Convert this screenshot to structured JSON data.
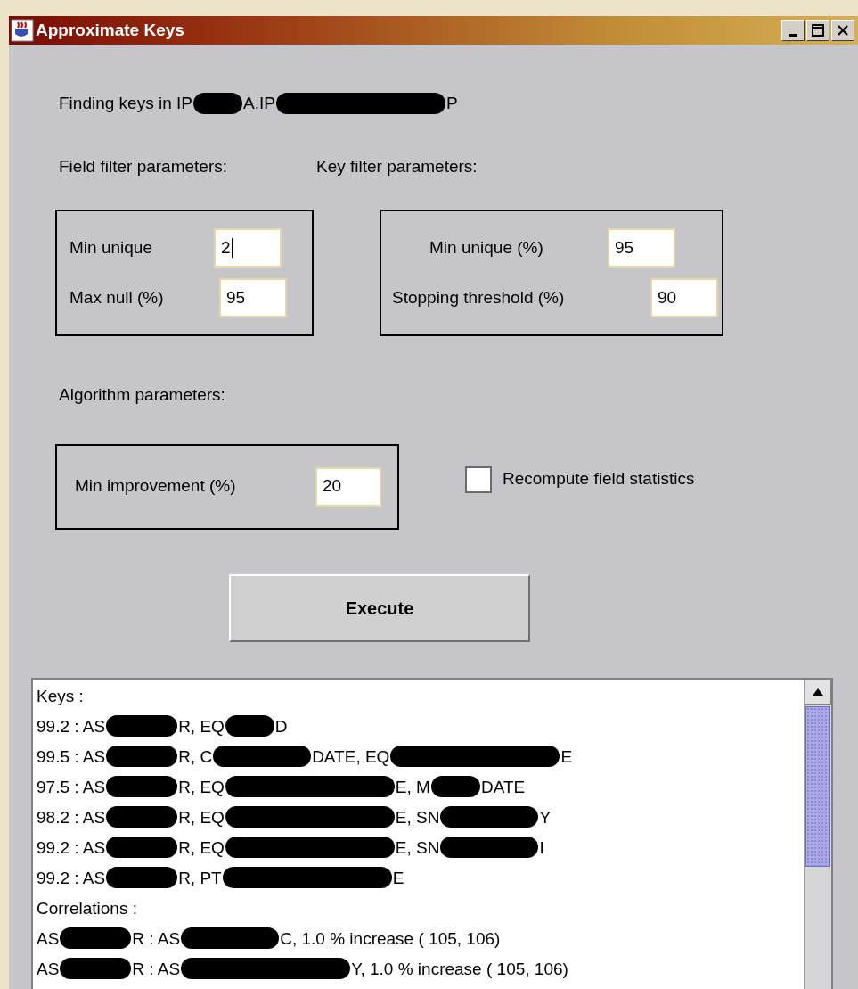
{
  "window": {
    "title": "Approximate Keys"
  },
  "heading": [
    {
      "kind": "text",
      "text": "Finding keys in IP"
    },
    {
      "kind": "short"
    },
    {
      "kind": "text",
      "text": "A.IP"
    },
    {
      "kind": "xlong"
    },
    {
      "kind": "text",
      "text": "P"
    }
  ],
  "field_filter": {
    "label": "Field filter parameters:",
    "fields": [
      {
        "label": "Min unique",
        "value": "2",
        "focused": true
      },
      {
        "label": "Max null (%)",
        "value": "95",
        "focused": false
      }
    ]
  },
  "key_filter": {
    "label": "Key filter parameters:",
    "fields": [
      {
        "label": "Min unique (%)",
        "value": "95",
        "focused": false
      },
      {
        "label": "Stopping threshold (%)",
        "value": "90",
        "focused": false
      }
    ]
  },
  "algorithm": {
    "label": "Algorithm parameters:",
    "fields": [
      {
        "label": "Min improvement (%)",
        "value": "20",
        "focused": false
      }
    ]
  },
  "recompute": {
    "label": "Recompute field statistics",
    "checked": false
  },
  "execute_button": "Execute",
  "output_lines": [
    [
      {
        "kind": "text",
        "text": "Keys :"
      }
    ],
    [
      {
        "kind": "text",
        "text": "99.2 : AS"
      },
      {
        "kind": "medium"
      },
      {
        "kind": "text",
        "text": "R, EQ"
      },
      {
        "kind": "short"
      },
      {
        "kind": "text",
        "text": "D"
      }
    ],
    [
      {
        "kind": "text",
        "text": "99.5 : AS"
      },
      {
        "kind": "medium"
      },
      {
        "kind": "text",
        "text": "R, C"
      },
      {
        "kind": "long"
      },
      {
        "kind": "text",
        "text": "DATE, EQ"
      },
      {
        "kind": "xlong"
      },
      {
        "kind": "text",
        "text": "E"
      }
    ],
    [
      {
        "kind": "text",
        "text": "97.5 : AS"
      },
      {
        "kind": "medium"
      },
      {
        "kind": "text",
        "text": "R, EQ"
      },
      {
        "kind": "xlong"
      },
      {
        "kind": "text",
        "text": "E, M"
      },
      {
        "kind": "short"
      },
      {
        "kind": "text",
        "text": "DATE"
      }
    ],
    [
      {
        "kind": "text",
        "text": "98.2 : AS"
      },
      {
        "kind": "medium"
      },
      {
        "kind": "text",
        "text": "R, EQ"
      },
      {
        "kind": "xlong"
      },
      {
        "kind": "text",
        "text": "E, SN"
      },
      {
        "kind": "long"
      },
      {
        "kind": "text",
        "text": "Y"
      }
    ],
    [
      {
        "kind": "text",
        "text": "99.2 : AS"
      },
      {
        "kind": "medium"
      },
      {
        "kind": "text",
        "text": "R, EQ"
      },
      {
        "kind": "xlong"
      },
      {
        "kind": "text",
        "text": "E, SN"
      },
      {
        "kind": "long"
      },
      {
        "kind": "text",
        "text": "I"
      }
    ],
    [
      {
        "kind": "text",
        "text": "99.2 : AS"
      },
      {
        "kind": "medium"
      },
      {
        "kind": "text",
        "text": "R, PT"
      },
      {
        "kind": "xlong"
      },
      {
        "kind": "text",
        "text": "E"
      }
    ],
    [
      {
        "kind": "text",
        "text": "Correlations :"
      }
    ],
    [
      {
        "kind": "text",
        "text": "AS"
      },
      {
        "kind": "medium"
      },
      {
        "kind": "text",
        "text": "R : AS"
      },
      {
        "kind": "long"
      },
      {
        "kind": "text",
        "text": "C, 1.0 % increase ( 105, 106)"
      }
    ],
    [
      {
        "kind": "text",
        "text": "AS"
      },
      {
        "kind": "medium"
      },
      {
        "kind": "text",
        "text": "R : AS"
      },
      {
        "kind": "xlong"
      },
      {
        "kind": "text",
        "text": "Y, 1.0 % increase ( 105, 106)"
      }
    ]
  ]
}
